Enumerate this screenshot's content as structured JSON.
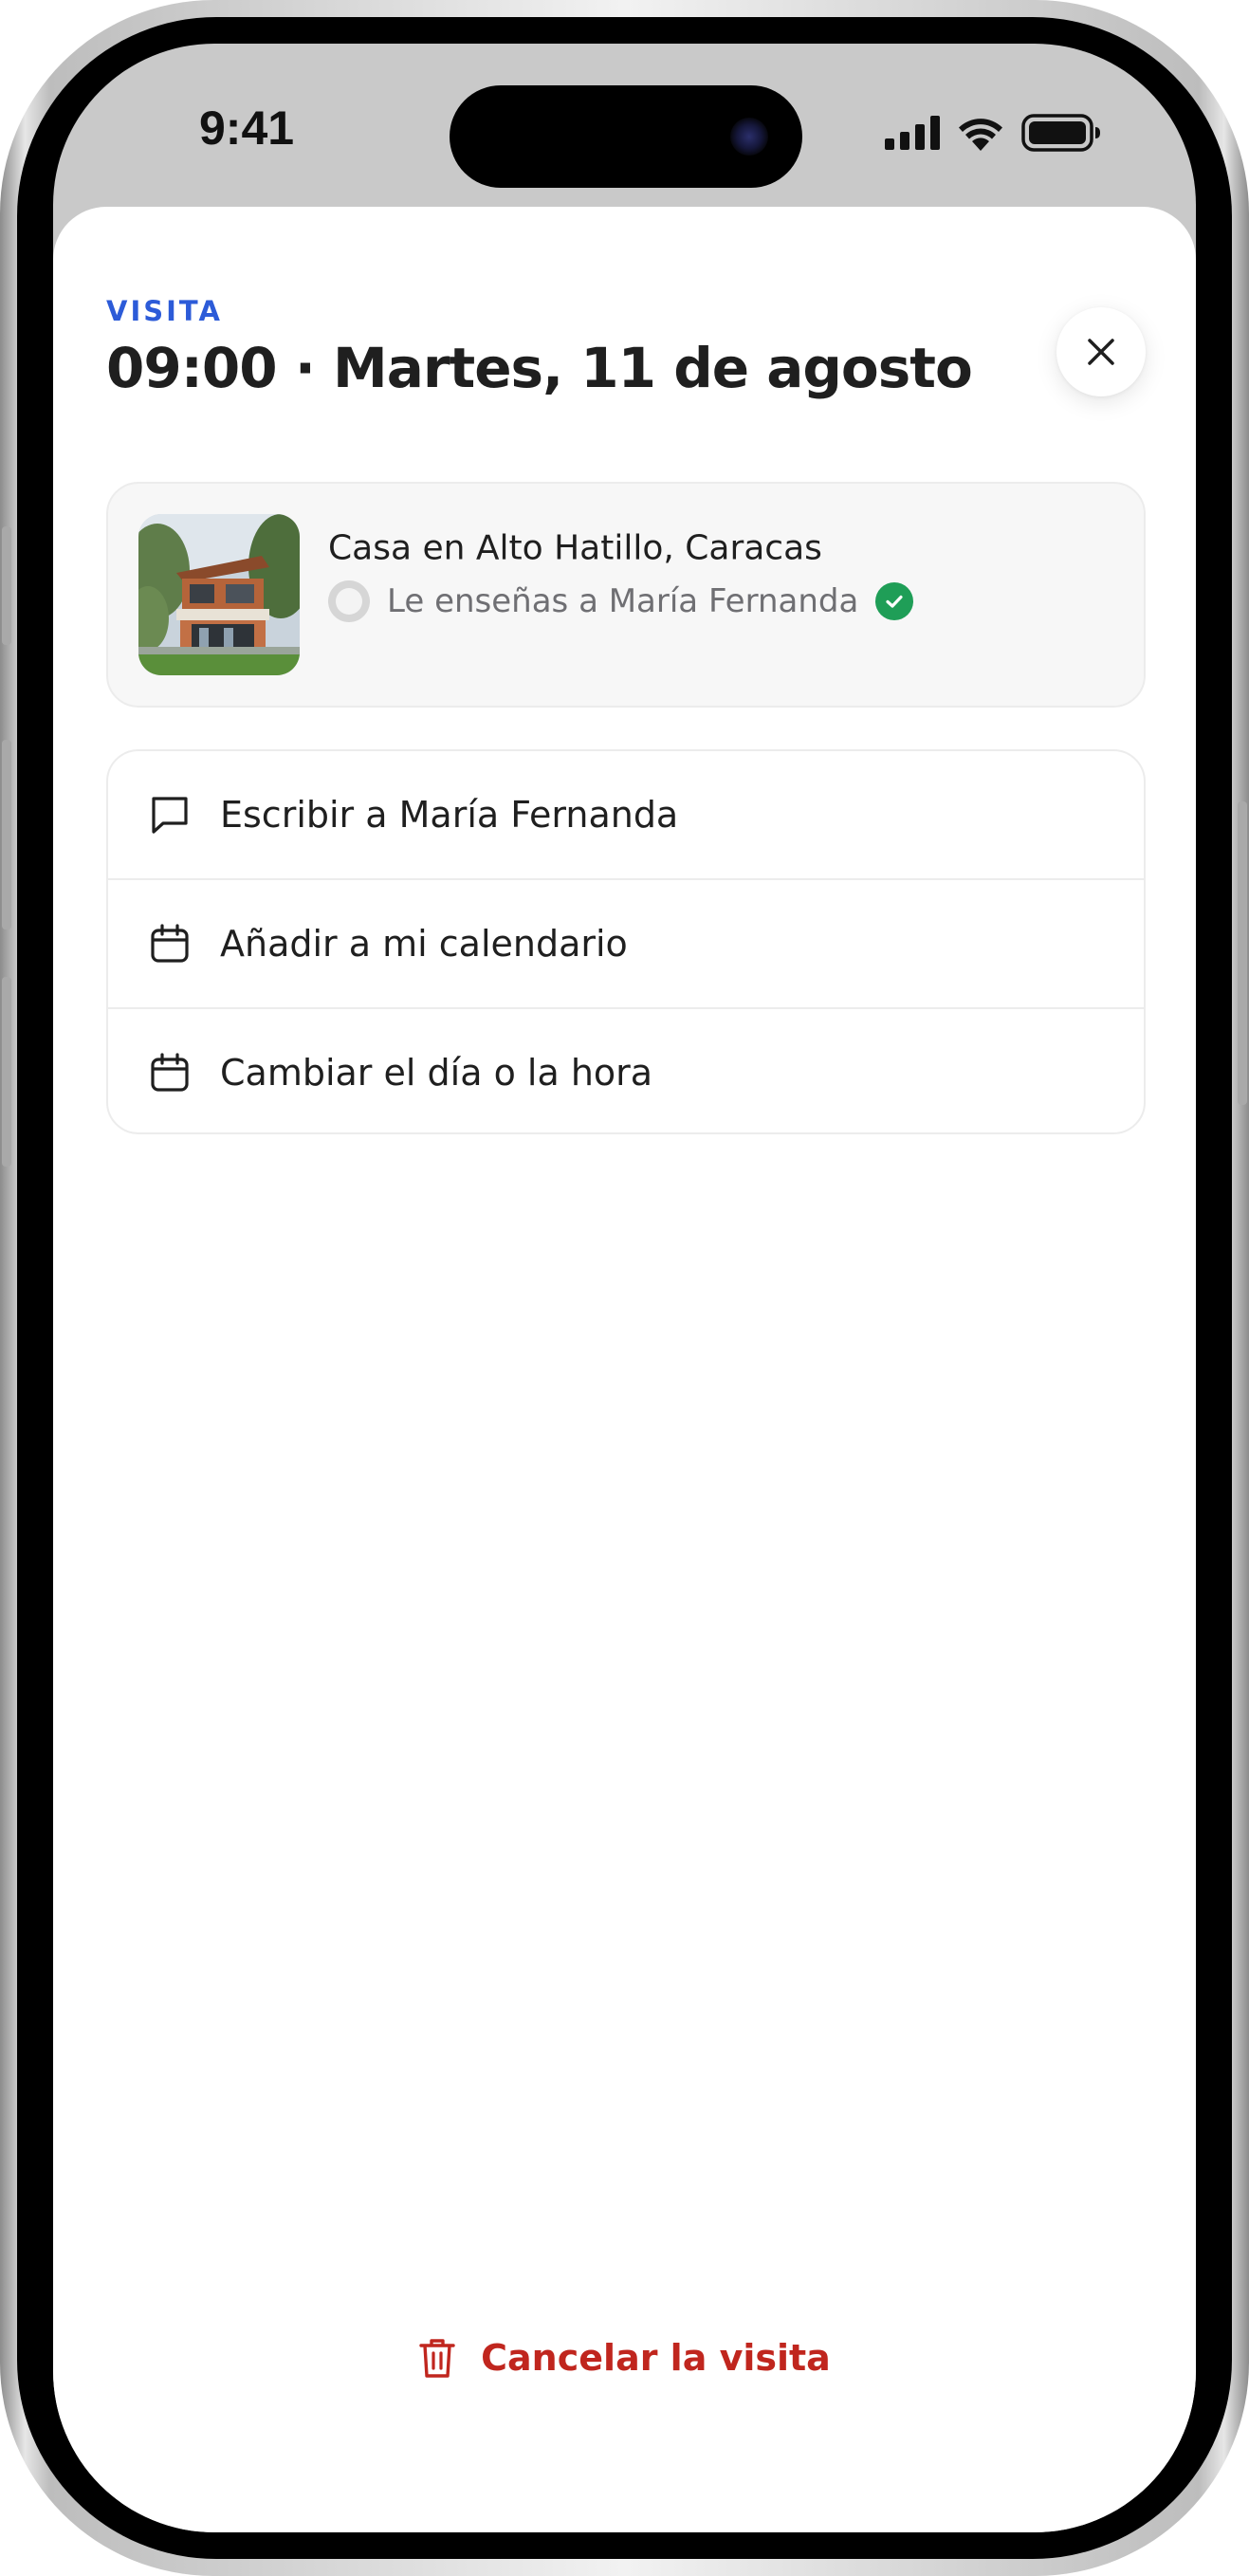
{
  "status_bar": {
    "time": "9:41",
    "icons": [
      "signal-icon",
      "wifi-icon",
      "battery-icon"
    ]
  },
  "sheet": {
    "eyebrow": "VISITA",
    "title": "09:00 · Martes, 11 de agosto",
    "close_icon": "close-icon"
  },
  "listing": {
    "title": "Casa en Alto Hatillo, Caracas",
    "host_text": "Le enseñas a María Fernanda",
    "verified_icon": "check-circle-icon"
  },
  "actions": [
    {
      "label": "Escribir a María Fernanda",
      "icon": "chat-bubble-icon"
    },
    {
      "label": "Añadir a mi calendario",
      "icon": "calendar-icon"
    },
    {
      "label": "Cambiar el día o la hora",
      "icon": "calendar-icon"
    }
  ],
  "cancel": {
    "label": "Cancelar la visita",
    "icon": "trash-icon"
  },
  "colors": {
    "accent_blue": "#2c5bd8",
    "danger_red": "#c0261e",
    "verified_green": "#1f9e57",
    "text_primary": "#1f1f1f",
    "text_secondary": "#6f6f73"
  }
}
